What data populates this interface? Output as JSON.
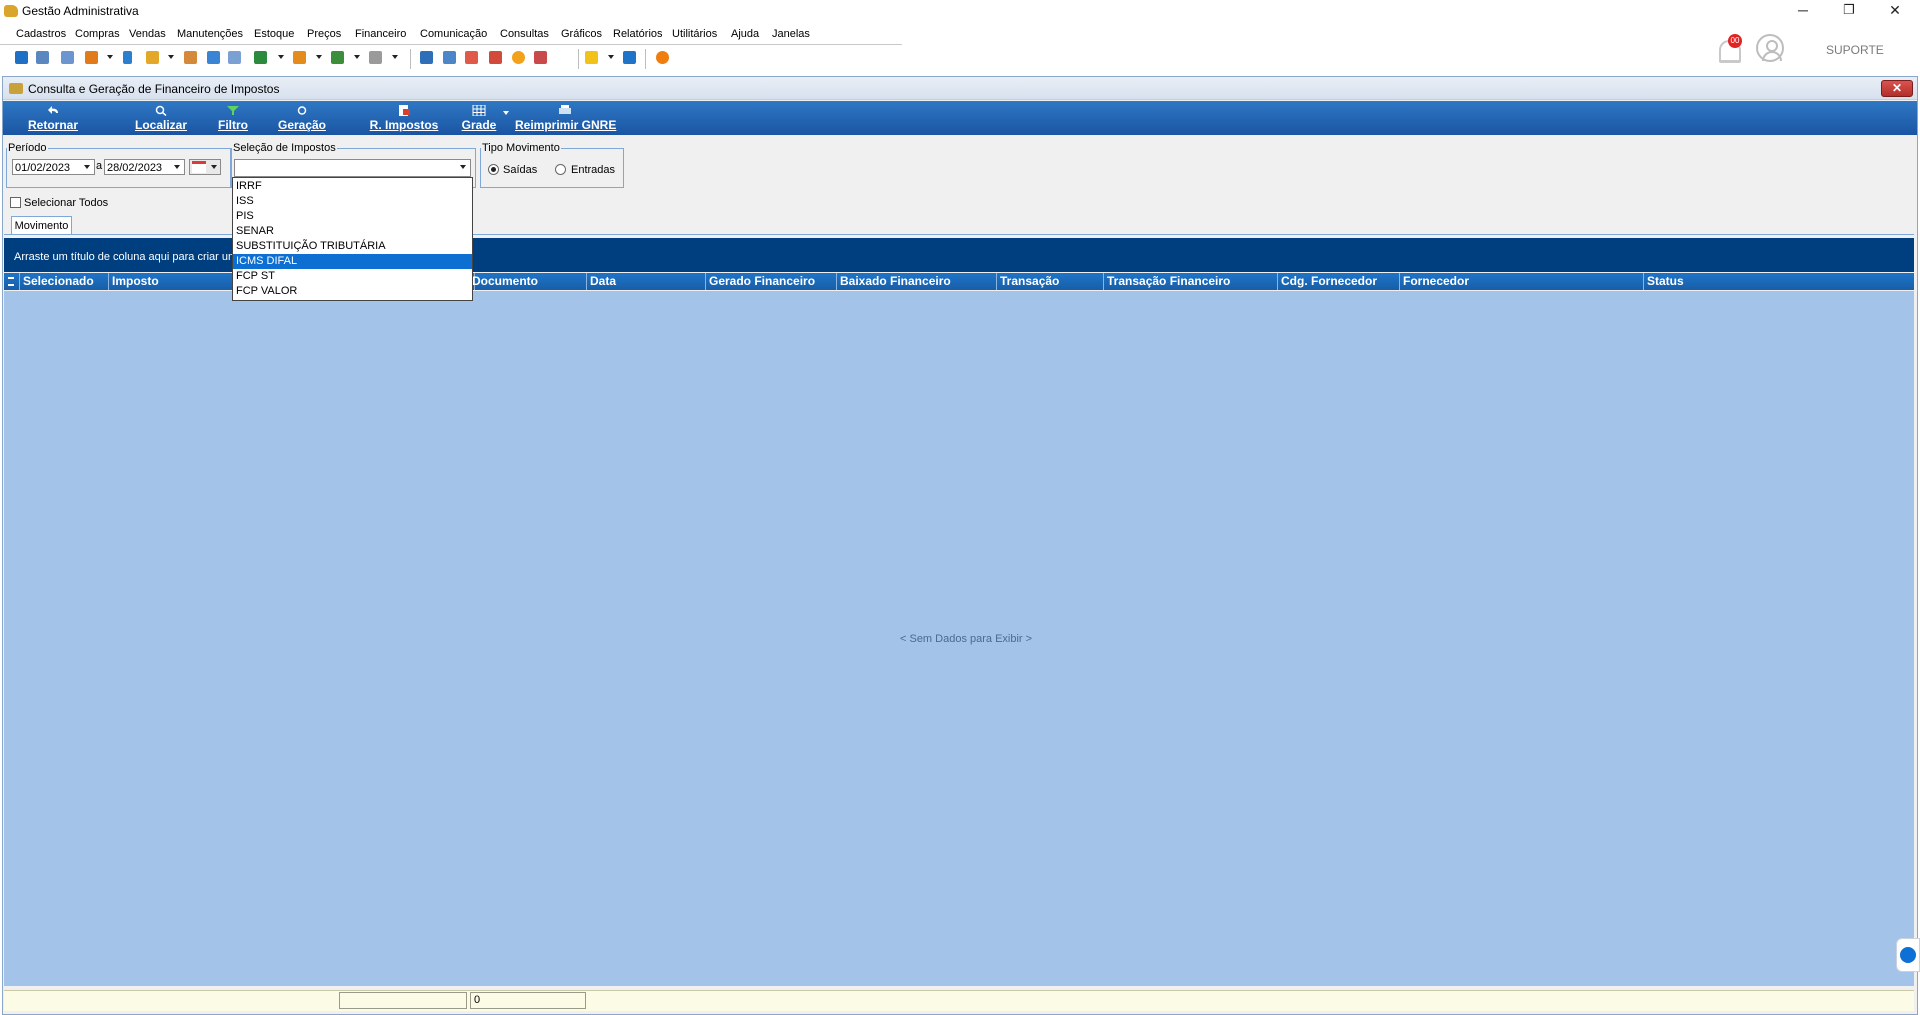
{
  "app": {
    "title": "Gestão Administrativa"
  },
  "window_controls": {
    "minimize": "─",
    "restore": "❐",
    "close": "✕"
  },
  "menu": [
    "Cadastros",
    "Compras",
    "Vendas",
    "Manutenções",
    "Estoque",
    "Preços",
    "Financeiro",
    "Comunicação",
    "Consultas",
    "Gráficos",
    "Relatórios",
    "Utilitários",
    "Ajuda",
    "Janelas"
  ],
  "notifications": {
    "badge": "00"
  },
  "user": {
    "name": "SUPORTE"
  },
  "window": {
    "title": "Consulta e Geração de Financeiro de Impostos",
    "close": "✕"
  },
  "actions": {
    "retornar": "Retornar",
    "localizar": "Localizar",
    "filtro": "Filtro",
    "geracao": "Geração",
    "r_impostos": "R. Impostos",
    "grade": "Grade",
    "reimprimir_gnre": "Reimprimir GNRE"
  },
  "periodo": {
    "legend": "Período",
    "from": "01/02/2023",
    "separator": "a",
    "to": "28/02/2023"
  },
  "impostos": {
    "legend": "Seleção de Impostos",
    "value": "",
    "options": [
      "IRRF",
      "ISS",
      "PIS",
      "SENAR",
      "SUBSTITUIÇÃO TRIBUTÁRIA",
      "ICMS DIFAL",
      "FCP ST",
      "FCP VALOR"
    ],
    "highlighted": "ICMS DIFAL"
  },
  "tipo_movimento": {
    "legend": "Tipo Movimento",
    "options": [
      "Saídas",
      "Entradas"
    ],
    "selected": "Saídas"
  },
  "select_all": {
    "label": "Selecionar Todos",
    "checked": false
  },
  "tabs": [
    {
      "label": "Movimento",
      "active": true
    }
  ],
  "grid": {
    "group_hint": "Arraste um título de coluna aqui para criar um",
    "columns": [
      "Selecionado",
      "Imposto",
      "Documento",
      "Data",
      "Gerado Financeiro",
      "Baixado Financeiro",
      "Transação",
      "Transação Financeiro",
      "Cdg. Fornecedor",
      "Fornecedor",
      "Status"
    ],
    "empty_message": "< Sem Dados para Exibir >"
  },
  "status": {
    "panel1": "",
    "panel2": "0"
  },
  "colors": {
    "action_bar": "#1a55a3",
    "group_panel": "#003f7f",
    "grid_body": "#a3c3e8",
    "selection": "#0c6fd1"
  }
}
